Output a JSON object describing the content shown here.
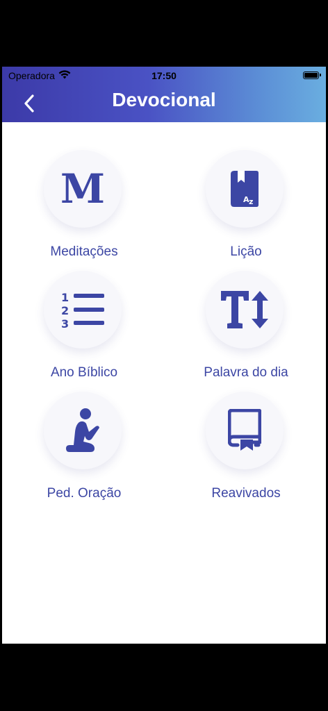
{
  "status_bar": {
    "carrier": "Operadora",
    "time": "17:50",
    "icons": [
      "wifi-icon",
      "battery-icon"
    ]
  },
  "header": {
    "title": "Devocional",
    "back_icon": "chevron-left-icon"
  },
  "colors": {
    "accent": "#3c46a4",
    "header_gradient_start": "#3c3aa8",
    "header_gradient_end": "#6aaee0",
    "circle_bg": "#f7f7fb"
  },
  "menu": {
    "items": [
      {
        "label": "Meditações",
        "icon": "letter-m-icon"
      },
      {
        "label": "Lição",
        "icon": "book-az-icon"
      },
      {
        "label": "Ano Bíblico",
        "icon": "numbered-list-icon"
      },
      {
        "label": "Palavra do dia",
        "icon": "text-height-icon"
      },
      {
        "label": "Ped. Oração",
        "icon": "praying-person-icon"
      },
      {
        "label": "Reavivados",
        "icon": "bookmark-book-icon"
      }
    ]
  }
}
